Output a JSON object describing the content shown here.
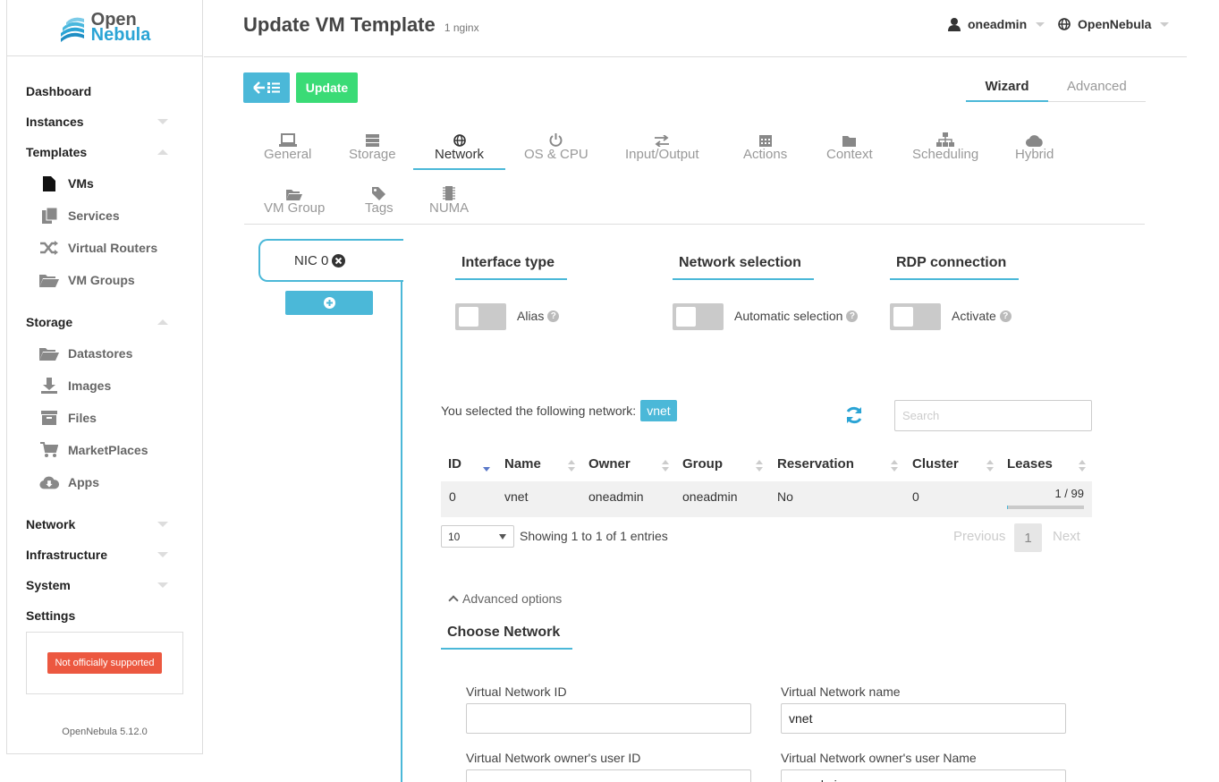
{
  "brand": {
    "line1": "Open",
    "line2": "Nebula"
  },
  "sidebar": {
    "dashboard": "Dashboard",
    "instances": "Instances",
    "templates": "Templates",
    "templates_items": [
      "VMs",
      "Services",
      "Virtual Routers",
      "VM Groups"
    ],
    "storage": "Storage",
    "storage_items": [
      "Datastores",
      "Images",
      "Files",
      "MarketPlaces",
      "Apps"
    ],
    "network": "Network",
    "infrastructure": "Infrastructure",
    "system": "System",
    "settings": "Settings",
    "support_badge": "Not officially supported",
    "version": "OpenNebula 5.12.0"
  },
  "header": {
    "title": "Update VM Template",
    "subtitle": "1 nginx",
    "user": "oneadmin",
    "zone": "OpenNebula"
  },
  "actions": {
    "update": "Update"
  },
  "mode_tabs": {
    "wizard": "Wizard",
    "advanced": "Advanced"
  },
  "section_tabs": [
    "General",
    "Storage",
    "Network",
    "OS & CPU",
    "Input/Output",
    "Actions",
    "Context",
    "Scheduling",
    "Hybrid",
    "VM Group",
    "Tags",
    "NUMA"
  ],
  "nic": {
    "label": "NIC 0"
  },
  "sections": {
    "interface_type": "Interface type",
    "network_selection": "Network selection",
    "rdp_connection": "RDP connection",
    "alias": "Alias",
    "automatic_selection": "Automatic selection",
    "activate": "Activate"
  },
  "selection": {
    "text": "You selected the following network:",
    "network": "vnet"
  },
  "search": {
    "placeholder": "Search"
  },
  "table": {
    "headers": [
      "ID",
      "Name",
      "Owner",
      "Group",
      "Reservation",
      "Cluster",
      "Leases"
    ],
    "rows": [
      {
        "id": "0",
        "name": "vnet",
        "owner": "oneadmin",
        "group": "oneadmin",
        "reservation": "No",
        "cluster": "0",
        "leases": "1 / 99",
        "lease_fraction": 0.01
      }
    ]
  },
  "pagination": {
    "length": "10",
    "showing": "Showing 1 to 1 of 1 entries",
    "previous": "Previous",
    "current": "1",
    "next": "Next"
  },
  "advanced_options": "Advanced options",
  "choose_network": {
    "title": "Choose Network",
    "vnet_id_label": "Virtual Network ID",
    "vnet_id_value": "",
    "vnet_name_label": "Virtual Network name",
    "vnet_name_value": "vnet",
    "owner_uid_label": "Virtual Network owner's user ID",
    "owner_uname_label": "Virtual Network owner's user Name",
    "owner_uname_value": "oneadmin"
  },
  "colors": {
    "accent": "#4bb8d8",
    "success": "#3adb76",
    "alert": "#ec5840"
  }
}
